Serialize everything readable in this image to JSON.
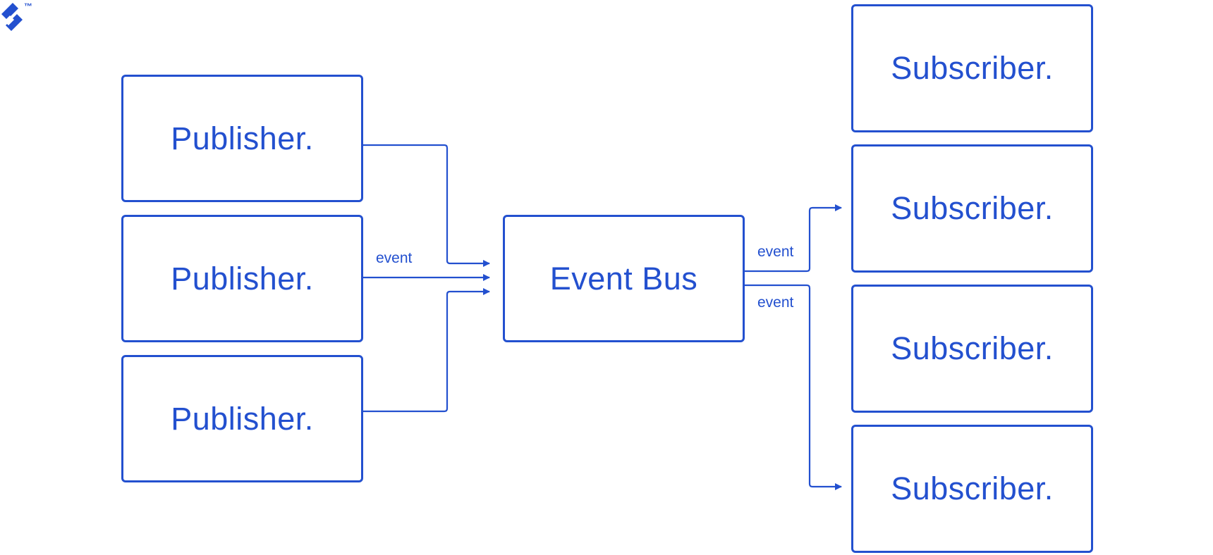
{
  "logo": {
    "icon": "toptal-logo-icon",
    "trademark": "™"
  },
  "publishers": [
    {
      "label": "Publisher."
    },
    {
      "label": "Publisher."
    },
    {
      "label": "Publisher."
    }
  ],
  "bus": {
    "label": "Event Bus"
  },
  "subscribers": [
    {
      "label": "Subscriber."
    },
    {
      "label": "Subscriber."
    },
    {
      "label": "Subscriber."
    },
    {
      "label": "Subscriber."
    }
  ],
  "edge_labels": {
    "publisher_to_bus": "event",
    "bus_to_subscriber_upper": "event",
    "bus_to_subscriber_lower": "event"
  },
  "colors": {
    "accent": "#2350cf",
    "background": "#ffffff"
  }
}
